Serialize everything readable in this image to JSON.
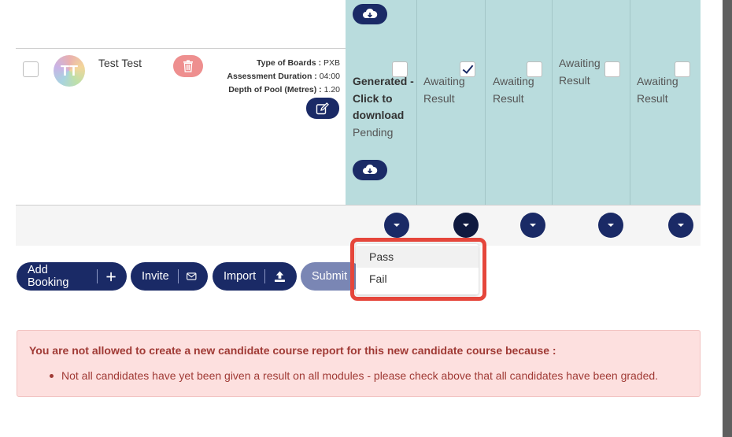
{
  "candidate": {
    "name": "Test Test",
    "avatar_initials": "TT",
    "details": [
      {
        "label": "Type of Boards :",
        "value": "PXB"
      },
      {
        "label": "Assessment Duration :",
        "value": "04:00"
      },
      {
        "label": "Depth of Pool (Metres) :",
        "value": "1.20"
      }
    ]
  },
  "modules": {
    "col1": {
      "status_bold": "Generated - Click to download",
      "status": "Pending"
    },
    "col2": {
      "status": "Awaiting Result",
      "checked": true
    },
    "col3": {
      "status": "Awaiting Result",
      "checked": false
    },
    "col4": {
      "status": "Awaiting Result",
      "checked": false
    },
    "col5": {
      "status": "Awaiting Result",
      "checked": false
    }
  },
  "actions": {
    "add_booking": "Add Booking",
    "invite": "Invite",
    "import": "Import",
    "submit": "Submit"
  },
  "dropdown": {
    "options": [
      "Pass",
      "Fail"
    ]
  },
  "alert": {
    "title": "You are not allowed to create a new candidate course report for this new candidate course because :",
    "items": [
      "Not all candidates have yet been given a result on all modules - please check above that all candidates have been graded."
    ]
  },
  "icons": {
    "download": "cloud-download-icon",
    "delete": "trash-icon",
    "edit": "edit-icon",
    "add": "plus-icon",
    "invite": "envelope-icon",
    "import": "upload-icon",
    "dropdown": "chevron-down-icon"
  },
  "colors": {
    "primary": "#1a2a66",
    "teal_bg": "#b9dcdd",
    "danger": "#ee8f8f",
    "alert_bg": "#fde0df",
    "alert_text": "#a03a35",
    "highlight": "#e5463b"
  }
}
